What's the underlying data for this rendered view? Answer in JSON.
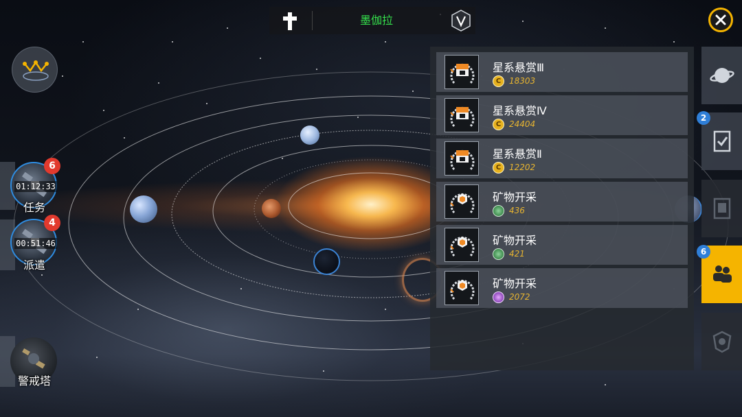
{
  "header": {
    "location_name": "墨伽拉",
    "left_icon": "cross-icon",
    "right_icon": "v-emblem-icon"
  },
  "left_menu": {
    "task": {
      "label": "任务",
      "timer": "01:12:33",
      "badge": "6"
    },
    "dispatch": {
      "label": "派遣",
      "timer": "00:51:46",
      "badge": "4"
    },
    "watchtower": {
      "label": "警戒塔"
    }
  },
  "missions": [
    {
      "title": "星系悬赏Ⅲ",
      "reward": "18303",
      "reward_type": "credits",
      "icon": "bounty-icon"
    },
    {
      "title": "星系悬赏Ⅳ",
      "reward": "24404",
      "reward_type": "credits",
      "icon": "bounty-icon"
    },
    {
      "title": "星系悬赏Ⅱ",
      "reward": "12202",
      "reward_type": "credits",
      "icon": "bounty-icon"
    },
    {
      "title": "矿物开采",
      "reward": "436",
      "reward_type": "green-ore",
      "icon": "mining-icon"
    },
    {
      "title": "矿物开采",
      "reward": "421",
      "reward_type": "green-ore",
      "icon": "mining-icon"
    },
    {
      "title": "矿物开采",
      "reward": "2072",
      "reward_type": "purple-crystal",
      "icon": "mining-icon"
    }
  ],
  "right_tabs": {
    "planet": {
      "icon": "planet-icon"
    },
    "checklist": {
      "icon": "checklist-icon",
      "badge": "2"
    },
    "archive": {
      "icon": "archive-icon"
    },
    "social": {
      "icon": "people-icon",
      "badge": "6",
      "active": true
    },
    "emblem": {
      "icon": "emblem-icon"
    }
  },
  "colors": {
    "accent": "#f5b400",
    "location_text": "#35e04c",
    "reward_text": "#e8b530",
    "alert_badge": "#e23a2e",
    "info_badge": "#2f7fd8"
  }
}
